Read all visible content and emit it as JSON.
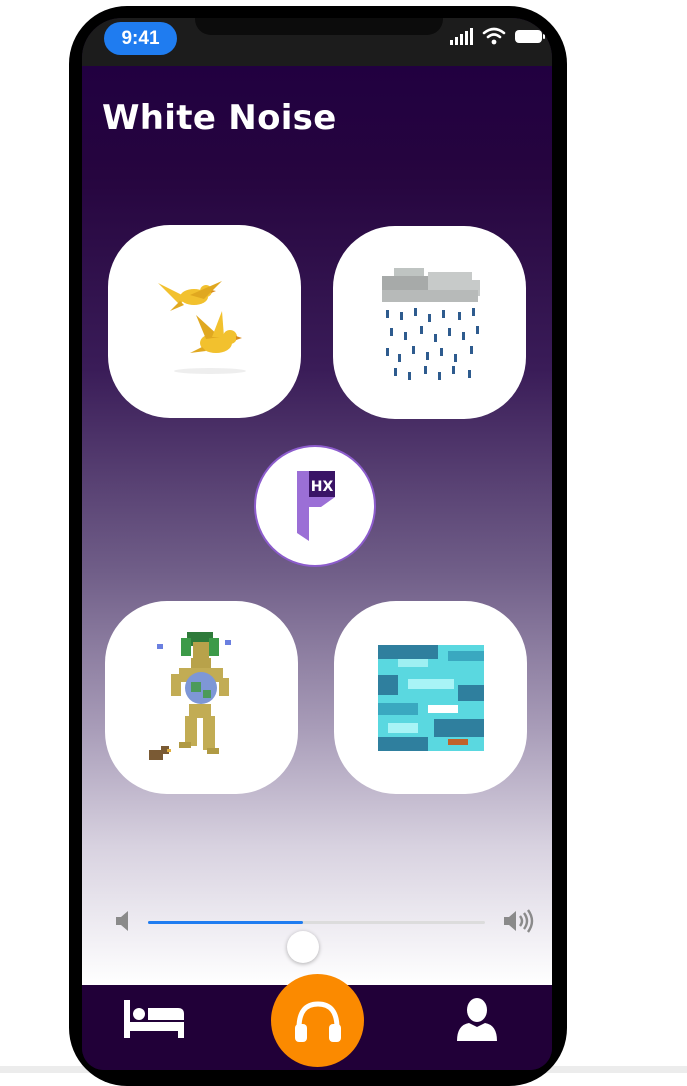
{
  "status_bar": {
    "time": "9:41",
    "icons": [
      "cellular-signal-icon",
      "wifi-icon",
      "battery-icon"
    ]
  },
  "header": {
    "title": "White Noise"
  },
  "sound_tiles": [
    {
      "name": "birds",
      "icon": "birds-icon"
    },
    {
      "name": "rain",
      "icon": "rain-cloud-icon"
    },
    {
      "name": "nature",
      "icon": "earth-goddess-icon"
    },
    {
      "name": "ocean",
      "icon": "ocean-waves-icon"
    }
  ],
  "center_logo": {
    "text": "HX",
    "icon": "hx-logo-icon"
  },
  "volume": {
    "level": 0.46,
    "low_icon": "volume-low-icon",
    "high_icon": "volume-high-icon"
  },
  "tab_bar": {
    "items": [
      "sleep-icon",
      "headphones-icon",
      "profile-icon"
    ],
    "active": "headphones"
  },
  "colors": {
    "background_top": "#210040",
    "accent_orange": "#fb8a00",
    "slider_blue": "#1f7cf0",
    "logo_purple": "#8c5ccc",
    "tab_bar": "#210038"
  }
}
